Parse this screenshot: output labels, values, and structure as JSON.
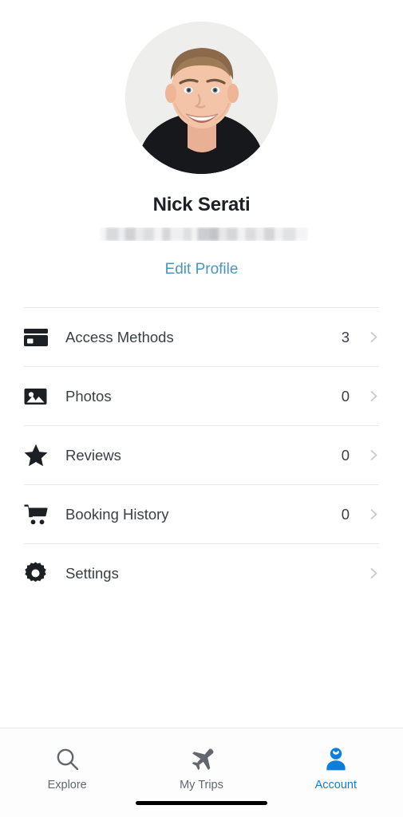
{
  "profile": {
    "name": "Nick Serati",
    "email_redacted": true,
    "edit_profile_label": "Edit Profile",
    "avatar_icon": "user-avatar-photo"
  },
  "menu": {
    "items": [
      {
        "label": "Access Methods",
        "value": "3",
        "icon": "credit-card-icon",
        "chevron": "chevron-right-icon"
      },
      {
        "label": "Photos",
        "value": "0",
        "icon": "photo-icon",
        "chevron": "chevron-right-icon"
      },
      {
        "label": "Reviews",
        "value": "0",
        "icon": "star-icon",
        "chevron": "chevron-right-icon"
      },
      {
        "label": "Booking History",
        "value": "0",
        "icon": "shopping-cart-icon",
        "chevron": "chevron-right-icon"
      },
      {
        "label": "Settings",
        "value": "",
        "icon": "gear-icon",
        "chevron": "chevron-right-icon"
      }
    ]
  },
  "tabbar": {
    "tabs": [
      {
        "label": "Explore",
        "icon": "search-icon",
        "active": false
      },
      {
        "label": "My Trips",
        "icon": "airplane-icon",
        "active": false
      },
      {
        "label": "Account",
        "icon": "person-icon",
        "active": true
      }
    ]
  },
  "colors": {
    "accent_blue": "#0b7fdb",
    "link_blue": "#4e95bb",
    "icon_dark": "#1c2024",
    "label_text": "#3a3f45",
    "chevron_gray": "#c6c7c9",
    "divider": "#e9e9ea",
    "inactive_tab": "#62676d"
  }
}
